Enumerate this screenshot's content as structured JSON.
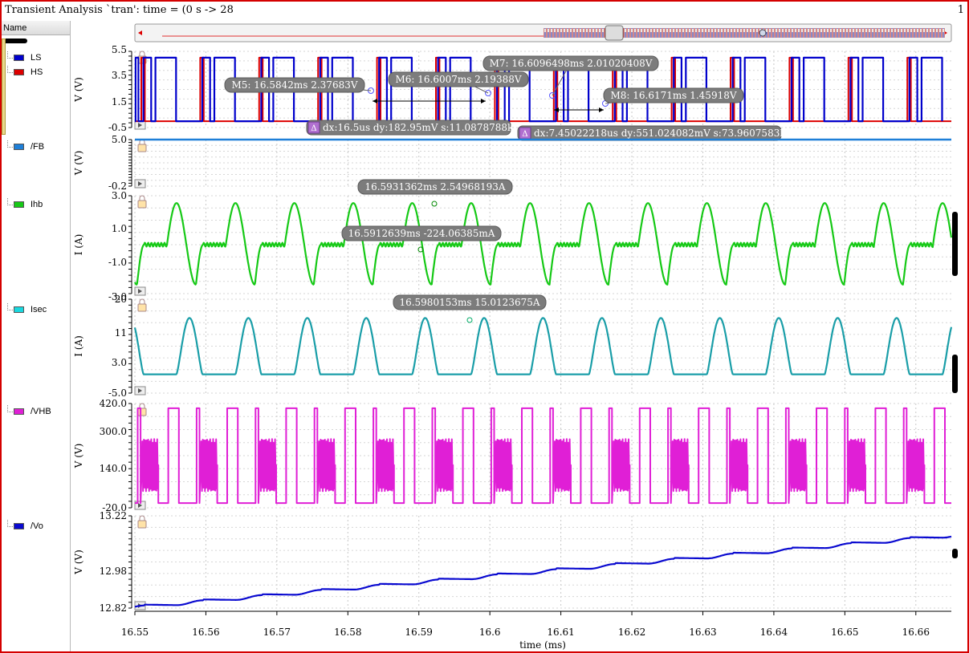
{
  "window": {
    "title": "Transient Analysis `tran': time = (0 s -> 28",
    "page_number": "1"
  },
  "sidebar": {
    "header": "Name",
    "items": [
      {
        "label": "LS",
        "color": "#0000cc"
      },
      {
        "label": "HS",
        "color": "#dd0000"
      },
      {
        "label": "/FB",
        "color": "#1e7fd8"
      },
      {
        "label": "Ihb",
        "color": "#16c916"
      },
      {
        "label": "Isec",
        "color": "#19d8df"
      },
      {
        "label": "/VHB",
        "color": "#e01fd6"
      },
      {
        "label": "/Vo",
        "color": "#0a0ad0"
      }
    ]
  },
  "chart_data": {
    "type": "line",
    "xlabel": "time (ms)",
    "xlim": [
      16.55,
      16.665
    ],
    "x_ticks": [
      "16.55",
      "16.56",
      "16.57",
      "16.58",
      "16.59",
      "16.6",
      "16.61",
      "16.62",
      "16.63",
      "16.64",
      "16.65",
      "16.66"
    ],
    "period_ms": 0.0083,
    "strips": [
      {
        "id": "gate",
        "ylabel": "V (V)",
        "ylim": [
          -0.5,
          5.5
        ],
        "y_ticks": [
          "5.5",
          "3.5",
          "1.5",
          "-0.5"
        ],
        "series": [
          {
            "name": "LS",
            "color": "#0000cc",
            "low": 0,
            "high": 5,
            "first_high_ms": [
              16.5508,
              16.5591
            ],
            "duty_fraction": 0.49
          },
          {
            "name": "HS",
            "color": "#dd0000",
            "low": 0,
            "high": 5
          }
        ],
        "markers": [
          {
            "text": "M5: 16.5842ms 2.37683V",
            "x": 16.5842,
            "y": 2.37683
          },
          {
            "text": "M6: 16.6007ms 2.19388V",
            "x": 16.6007,
            "y": 2.19388
          },
          {
            "text": "M7: 16.6096498ms 2.01020408V",
            "x": 16.6096498,
            "y": 2.01020408
          },
          {
            "text": "M8: 16.6171ms 1.45918V",
            "x": 16.6171,
            "y": 1.45918
          }
        ],
        "deltas": [
          {
            "text": "dx:16.5us dy:182.95mV s:11.0878788k"
          },
          {
            "text": "dx:7.45022218us dy:551.024082mV s:73.9607583k"
          }
        ]
      },
      {
        "id": "fb",
        "ylabel": "V (V)",
        "ylim": [
          -0.2,
          5.0
        ],
        "y_ticks": [
          "5.0",
          "-0.2"
        ],
        "series": [
          {
            "name": "/FB",
            "color": "#1e7fd8",
            "value": 5.0
          }
        ]
      },
      {
        "id": "ihb",
        "ylabel": "I (A)",
        "ylim": [
          -3.0,
          3.0
        ],
        "y_ticks": [
          "3.0",
          "1.0",
          "-1.0",
          "-3.0"
        ],
        "series": [
          {
            "name": "Ihb",
            "color": "#16c916",
            "peak": 2.55,
            "trough": -2.45,
            "plateau": 0.0
          }
        ],
        "markers": [
          {
            "text": "16.5931362ms 2.54968193A",
            "x": 16.5931362,
            "y": 2.54968193
          },
          {
            "text": "16.5912639ms -224.06385mA",
            "x": 16.5912639,
            "y": -0.22406385
          }
        ]
      },
      {
        "id": "isec",
        "ylabel": "I (A)",
        "ylim": [
          -5.0,
          20.0
        ],
        "y_ticks": [
          "20",
          "11",
          "3.0",
          "-5.0"
        ],
        "series": [
          {
            "name": "Isec",
            "color": "#1a9ea8",
            "peak": 15.01,
            "base": 0.0
          }
        ],
        "markers": [
          {
            "text": "16.5980153ms 15.0123675A",
            "x": 16.5980153,
            "y": 15.0123675
          }
        ]
      },
      {
        "id": "vhb",
        "ylabel": "V (V)",
        "ylim": [
          -20.0,
          420.0
        ],
        "y_ticks": [
          "420.0",
          "300.0",
          "140.0",
          "-20.0"
        ],
        "series": [
          {
            "name": "/VHB",
            "color": "#e01fd6",
            "high": 400,
            "low": 0
          }
        ]
      },
      {
        "id": "vo",
        "ylabel": "V (V)",
        "ylim": [
          12.82,
          13.22
        ],
        "y_ticks": [
          "13.22",
          "12.98",
          "12.82"
        ],
        "series": [
          {
            "name": "/Vo",
            "color": "#0a0ad0",
            "start": 12.835,
            "step": 0.0225
          }
        ]
      }
    ]
  }
}
